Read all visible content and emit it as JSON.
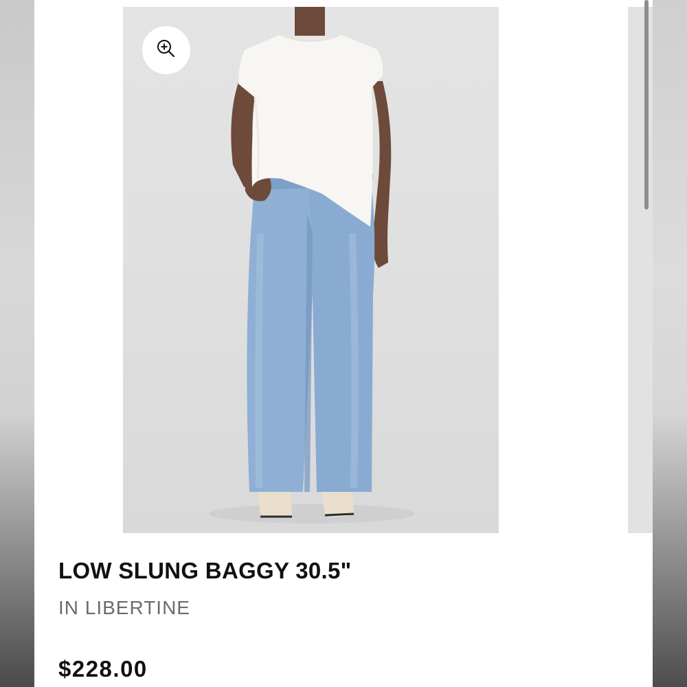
{
  "product": {
    "title": "LOW SLUNG BAGGY 30.5\"",
    "color_line": "IN LIBERTINE",
    "price": "$228.00"
  },
  "gallery": {
    "zoom_icon": "zoom-in-icon",
    "image_subject": "model-wearing-light-wash-baggy-jeans"
  },
  "colors": {
    "background": "#ffffff",
    "image_bg": "#e2e2e3",
    "title": "#111111",
    "subtitle": "#6b6b6b",
    "denim": "#8fb0d4",
    "top": "#f7f6f2"
  }
}
